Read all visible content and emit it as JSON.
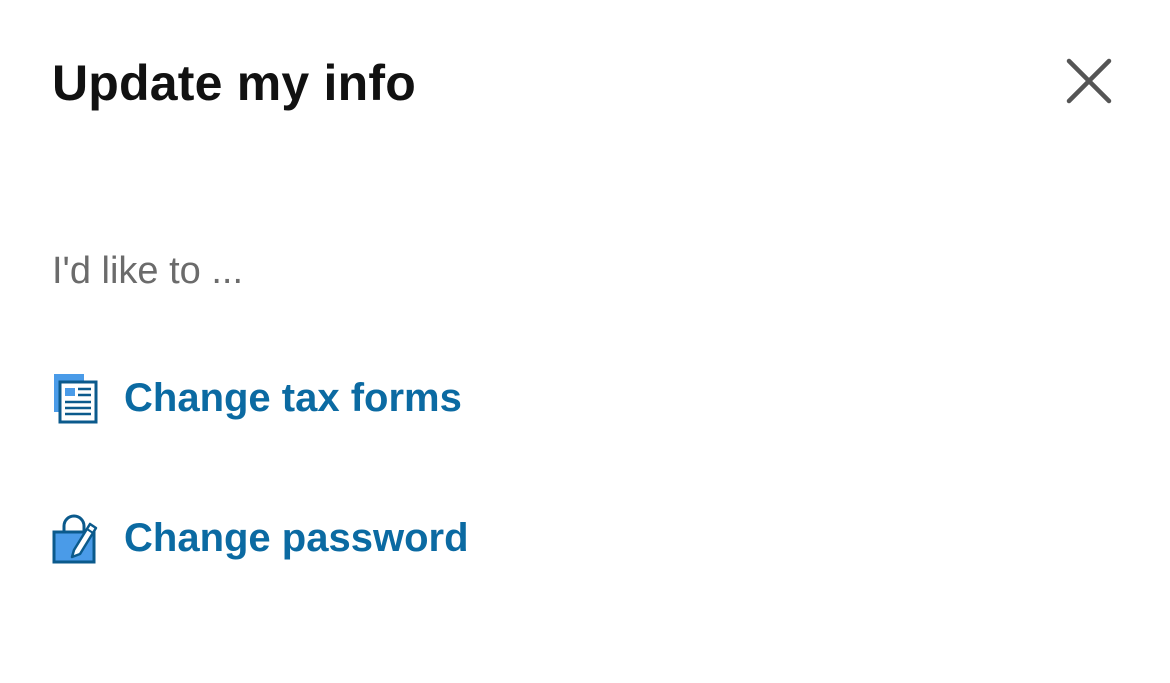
{
  "dialog": {
    "title": "Update my info",
    "close_icon": "close-icon",
    "prompt": "I'd like to ...",
    "actions": [
      {
        "label": "Change tax forms",
        "icon": "tax-form-icon"
      },
      {
        "label": "Change password",
        "icon": "lock-edit-icon"
      }
    ]
  },
  "colors": {
    "title": "#111111",
    "prompt": "#6b6b6b",
    "link": "#0b6aa2",
    "icon_accent": "#4a9be8",
    "icon_dark": "#0b5a8c",
    "close": "#555555"
  }
}
